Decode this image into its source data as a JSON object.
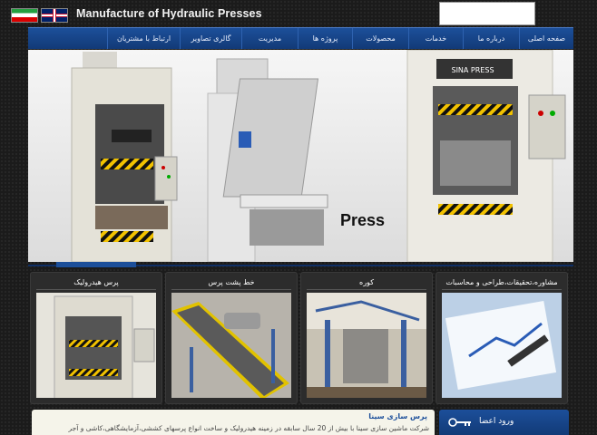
{
  "header": {
    "brand_title": "Manufacture of Hydraulic Presses",
    "flags": [
      "iran-flag-icon",
      "uk-flag-icon"
    ]
  },
  "nav": {
    "items": [
      {
        "label": "صفحه اصلی"
      },
      {
        "label": "درباره ما"
      },
      {
        "label": "خدمات"
      },
      {
        "label": "محصولات"
      },
      {
        "label": "پروژه ها"
      },
      {
        "label": "مدیریت"
      },
      {
        "label": "گالری تصاویر"
      },
      {
        "label": "ارتباط با مشتریان"
      }
    ]
  },
  "hero": {
    "press_label": "Press",
    "machine_badge": "SINA PRESS"
  },
  "panels": [
    {
      "title": "مشاوره،تحقیقات،طراحی و محاسبات"
    },
    {
      "title": "کوره"
    },
    {
      "title": "خط پشت پرس"
    },
    {
      "title": "پرس هیدرولیک"
    }
  ],
  "login": {
    "label": "ورود اعضا"
  },
  "about": {
    "title": "پرس سازی سینا",
    "text": "شرکت ماشین سازی سینا با بیش از 20 سال سابقه در زمینه هیدرولیک و ساخت انواع پرسهای کششی،آزمایشگاهی،کاشی و آجر"
  },
  "colors": {
    "nav_blue": "#1c4f9a",
    "background": "#1b1b1b"
  }
}
